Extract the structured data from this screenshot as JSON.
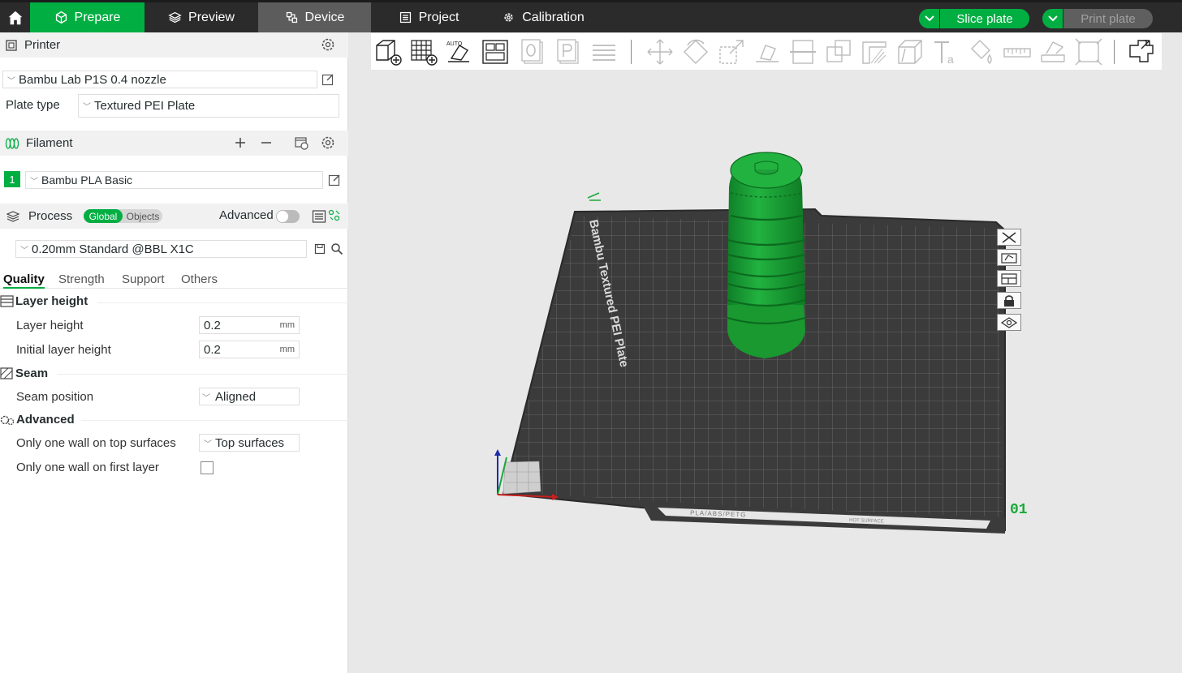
{
  "topbar": {
    "tabs": [
      {
        "label": "Prepare",
        "icon": "cube-icon"
      },
      {
        "label": "Preview",
        "icon": "layers-icon"
      },
      {
        "label": "Device",
        "icon": "device-icon"
      },
      {
        "label": "Project",
        "icon": "list-icon"
      },
      {
        "label": "Calibration",
        "icon": "gear-icon"
      }
    ],
    "slice_label": "Slice plate",
    "print_label": "Print plate",
    "accent": "#00ae42"
  },
  "printer": {
    "title": "Printer",
    "name": "Bambu Lab P1S 0.4 nozzle",
    "plate_type_label": "Plate type",
    "plate_type": "Textured PEI Plate"
  },
  "filament": {
    "title": "Filament",
    "slot": "1",
    "name": "Bambu PLA Basic"
  },
  "process": {
    "title": "Process",
    "scope_global": "Global",
    "scope_objects": "Objects",
    "advanced_label": "Advanced",
    "preset": "0.20mm Standard @BBL X1C"
  },
  "tabs": {
    "quality": "Quality",
    "strength": "Strength",
    "support": "Support",
    "others": "Others"
  },
  "groups": {
    "layer_height": {
      "title": "Layer height",
      "layer_height_label": "Layer height",
      "layer_height_value": "0.2",
      "initial_layer_label": "Initial layer height",
      "initial_layer_value": "0.2",
      "unit": "mm"
    },
    "seam": {
      "title": "Seam",
      "position_label": "Seam position",
      "position_value": "Aligned"
    },
    "advanced": {
      "title": "Advanced",
      "one_wall_top_label": "Only one wall on top surfaces",
      "one_wall_top_value": "Top surfaces",
      "one_wall_first_label": "Only one wall on first layer"
    }
  },
  "plate": {
    "plate_text": "Bambu Textured PEI Plate",
    "plate_number": "01",
    "bottom_label": "PLA/ABS/PETG",
    "hot_label": "HOT SURFACE",
    "model_color": "#1aa83a"
  }
}
